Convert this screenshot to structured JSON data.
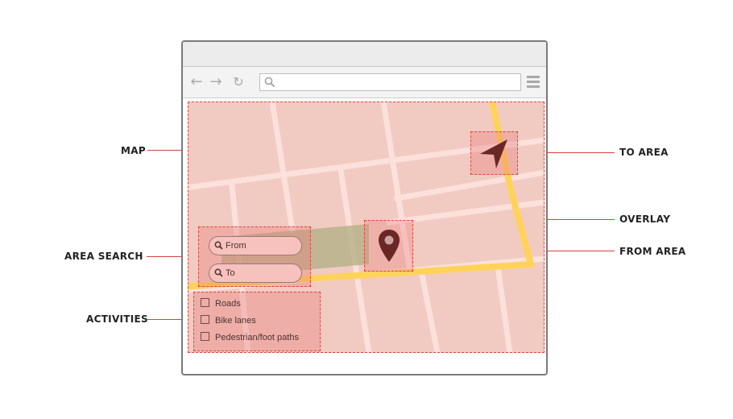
{
  "callouts": {
    "map": "MAP",
    "area_search": "AREA SEARCH",
    "activities": "ACTIVITIES",
    "to_area": "TO AREA",
    "overlay": "OVERLAY",
    "from_area": "FROM AREA"
  },
  "search": {
    "from_label": "From",
    "to_label": "To"
  },
  "activities": [
    {
      "label": "Roads",
      "checked": false
    },
    {
      "label": "Bike lanes",
      "checked": false
    },
    {
      "label": "Pedestrian/foot paths",
      "checked": false
    }
  ],
  "icons": {
    "back": "arrow-left-icon",
    "forward": "arrow-right-icon",
    "reload": "reload-icon",
    "address_search": "search-icon",
    "menu": "hamburger-icon",
    "from_marker": "map-pin-icon",
    "to_marker": "navigation-arrow-icon"
  },
  "colors": {
    "map_background": "#f1cbc1",
    "street": "#fbe0dc",
    "route": "#ffd35a",
    "annotation": "#e0443a",
    "marker": "#6b2626",
    "highlight_overlay": "#b9b38c"
  }
}
